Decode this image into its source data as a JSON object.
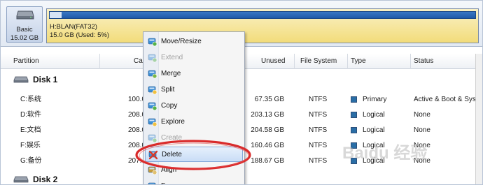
{
  "diskmap": {
    "disk_label": "Basic",
    "disk_size": "15.02 GB",
    "partition_label": "H:BLAN(FAT32)",
    "partition_usage": "15.0 GB (Used: 5%)",
    "used_fraction": 0.05
  },
  "columns": [
    "Partition",
    "Ca",
    "Unused",
    "File System",
    "Type",
    "Status"
  ],
  "disks": [
    {
      "label": "Disk 1",
      "rows": [
        {
          "partition": "C:系统",
          "capacity": "100.0",
          "unused": "67.35 GB",
          "fs": "NTFS",
          "type": "Primary",
          "status": "Active & Boot & Syst"
        },
        {
          "partition": "D:软件",
          "capacity": "208.0",
          "unused": "203.13 GB",
          "fs": "NTFS",
          "type": "Logical",
          "status": "None"
        },
        {
          "partition": "E:文档",
          "capacity": "208.0",
          "unused": "204.58 GB",
          "fs": "NTFS",
          "type": "Logical",
          "status": "None"
        },
        {
          "partition": "F:娱乐",
          "capacity": "208.0",
          "unused": "160.46 GB",
          "fs": "NTFS",
          "type": "Logical",
          "status": "None"
        },
        {
          "partition": "G:备份",
          "capacity": "207.",
          "unused": "188.67 GB",
          "fs": "NTFS",
          "type": "Logical",
          "status": "None"
        }
      ]
    },
    {
      "label": "Disk 2",
      "rows": []
    }
  ],
  "context_menu": [
    {
      "label": "Move/Resize",
      "icon": "move-resize-icon",
      "enabled": true
    },
    {
      "label": "Extend",
      "icon": "extend-icon",
      "enabled": false
    },
    {
      "label": "Merge",
      "icon": "merge-icon",
      "enabled": true
    },
    {
      "label": "Split",
      "icon": "split-icon",
      "enabled": true
    },
    {
      "label": "Copy",
      "icon": "copy-icon",
      "enabled": true
    },
    {
      "label": "Explore",
      "icon": "explore-icon",
      "enabled": true
    },
    {
      "label": "Create",
      "icon": "create-icon",
      "enabled": false
    },
    {
      "label": "Delete",
      "icon": "delete-icon",
      "enabled": true,
      "highlighted": true
    },
    {
      "label": "Align",
      "icon": "align-icon",
      "enabled": true
    },
    {
      "label": "F",
      "icon": "format-icon",
      "enabled": true
    }
  ],
  "watermark": "Baidu 经验",
  "colors": {
    "partition_bar": "#f2dc7a",
    "usage_bar": "#1f5aa8",
    "type_square": "#2a6ea6",
    "annotation": "#d92b2b",
    "menu_highlight": "#c9ddf6"
  }
}
